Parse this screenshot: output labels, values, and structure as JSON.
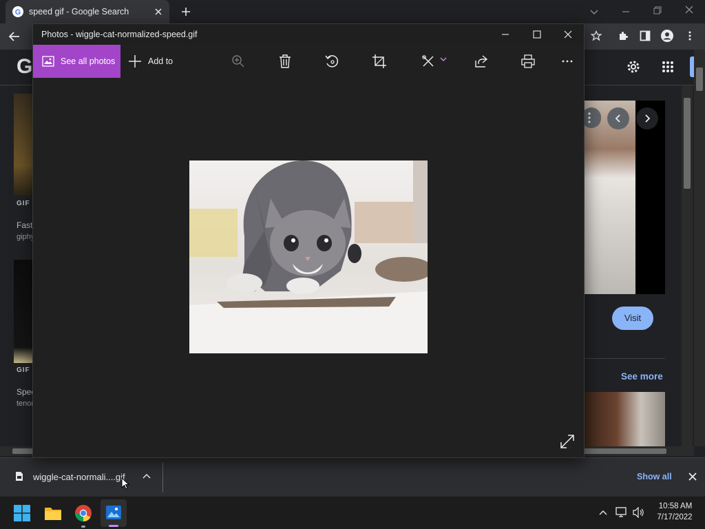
{
  "browser": {
    "tab_title": "speed gif - Google Search",
    "google_letter": "G",
    "side_results": [
      {
        "badge": "GIF",
        "title": "Fast",
        "source": "giphy"
      },
      {
        "badge": "GIF",
        "title": "Spee",
        "source": "tenor"
      }
    ],
    "visit_label": "Visit",
    "see_more_label": "See more"
  },
  "photos": {
    "window_title": "Photos - wiggle-cat-normalized-speed.gif",
    "see_all_label": "See all photos",
    "add_to_label": "Add to",
    "accent": "#a245c9"
  },
  "downloads": {
    "filename": "wiggle-cat-normali....gif",
    "show_all_label": "Show all"
  },
  "taskbar": {
    "time": "10:58 AM",
    "date": "7/17/2022"
  }
}
